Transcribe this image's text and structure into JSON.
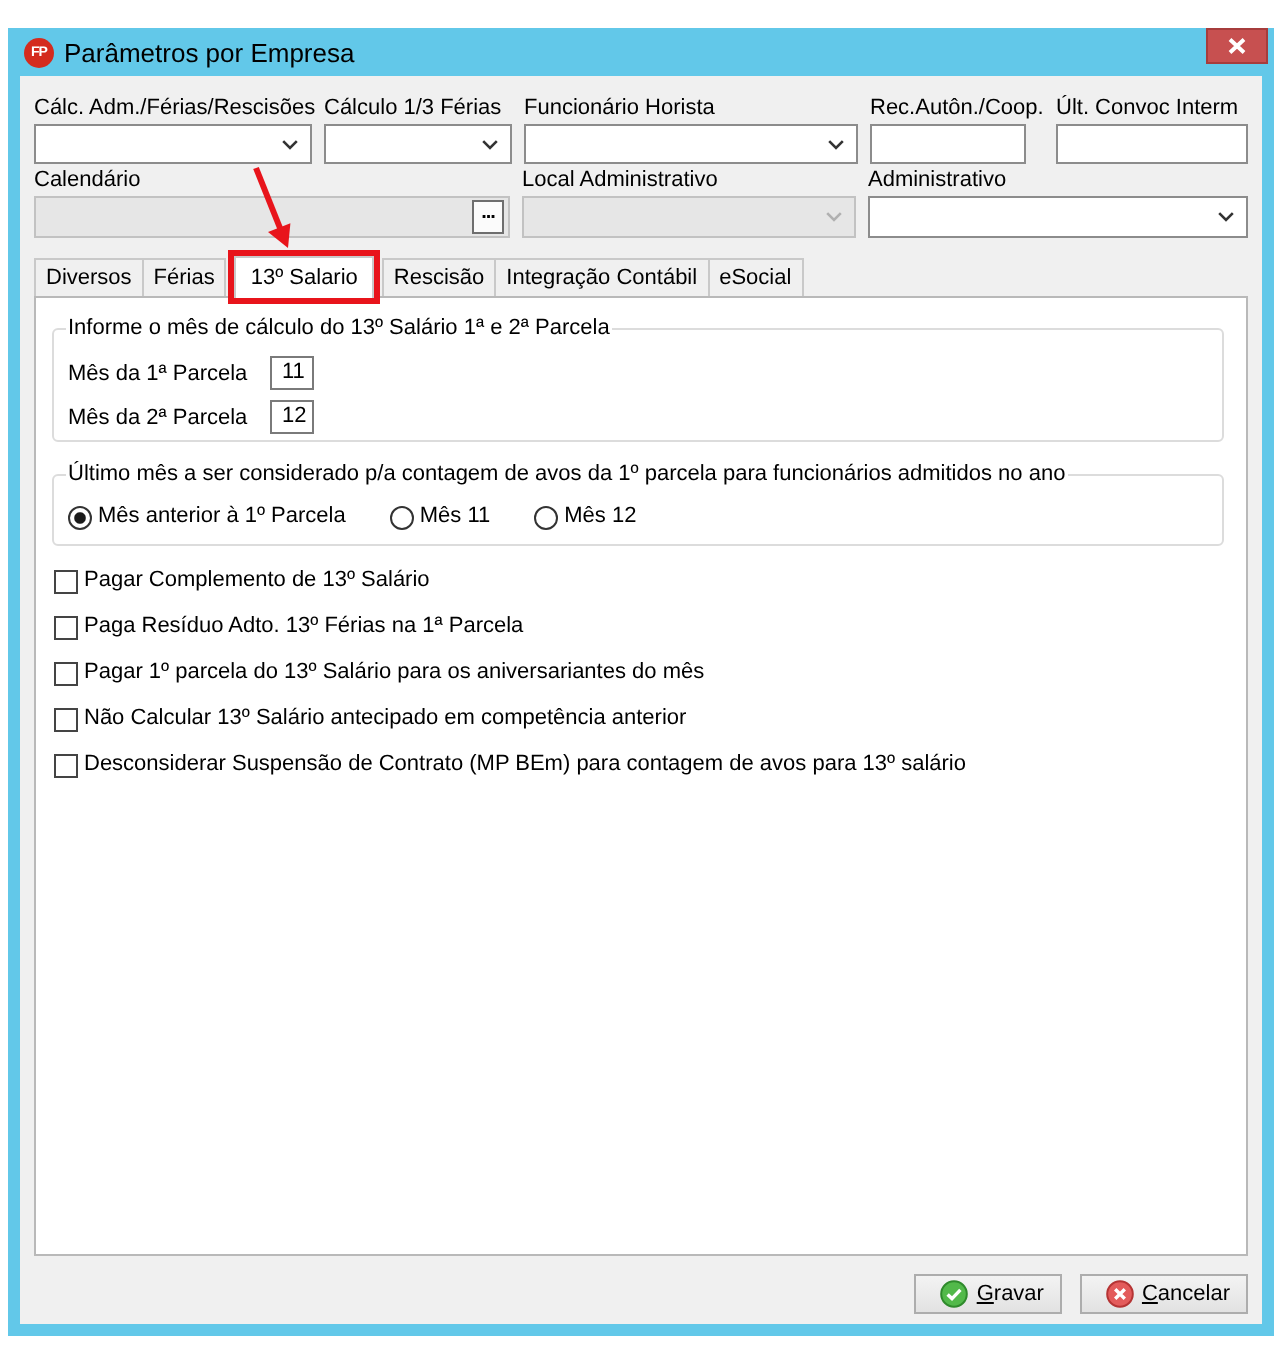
{
  "window": {
    "title": "Parâmetros por Empresa",
    "icon_text": "FP"
  },
  "field_rows": [
    [
      {
        "label": "Cálc. Adm./Férias/Rescisões",
        "kind": "combo",
        "disabled": false
      },
      {
        "label": "Cálculo 1/3 Férias",
        "kind": "combo",
        "disabled": false
      },
      {
        "label": "Funcionário Horista",
        "kind": "combo",
        "disabled": false
      },
      {
        "label": "Rec.Autôn./Coop.",
        "kind": "text",
        "disabled": false
      },
      {
        "label": "Últ. Convoc Interm",
        "kind": "text",
        "disabled": false
      }
    ],
    [
      {
        "label": "Calendário",
        "kind": "browse",
        "disabled": true,
        "button": "..."
      },
      {
        "label": "Local Administrativo",
        "kind": "combo",
        "disabled": true
      },
      {
        "label": "Administrativo",
        "kind": "combo",
        "disabled": false
      }
    ]
  ],
  "tabs": [
    {
      "label": "Diversos",
      "selected": false,
      "highlighted": false
    },
    {
      "label": "Férias",
      "selected": false,
      "highlighted": false
    },
    {
      "label": "13º Salario",
      "selected": true,
      "highlighted": true
    },
    {
      "label": "Rescisão",
      "selected": false,
      "highlighted": false
    },
    {
      "label": "Integração Contábil",
      "selected": false,
      "highlighted": false
    },
    {
      "label": "eSocial",
      "selected": false,
      "highlighted": false
    }
  ],
  "groups": [
    {
      "title": "Informe o mês de cálculo do 13º Salário 1ª e 2ª Parcela",
      "kind": "inputs",
      "rows": [
        {
          "label": "Mês da 1ª Parcela",
          "value": "11"
        },
        {
          "label": "Mês da 2ª Parcela",
          "value": "12"
        }
      ]
    },
    {
      "title": "Último mês a ser considerado p/a contagem de avos da 1º parcela para funcionários admitidos no ano",
      "kind": "radios",
      "options": [
        {
          "label": "Mês anterior à 1º Parcela",
          "selected": true
        },
        {
          "label": "Mês 11",
          "selected": false
        },
        {
          "label": "Mês 12",
          "selected": false
        }
      ]
    }
  ],
  "checkboxes": [
    {
      "label": "Pagar Complemento de 13º Salário",
      "checked": false
    },
    {
      "label": "Paga Resíduo Adto. 13º Férias na 1ª Parcela",
      "checked": false
    },
    {
      "label": "Pagar 1º parcela do 13º Salário para os aniversariantes do mês",
      "checked": false
    },
    {
      "label": "Não Calcular 13º Salário antecipado em competência anterior",
      "checked": false
    },
    {
      "label": "Desconsiderar Suspensão de Contrato (MP BEm) para contagem de avos para 13º salário",
      "checked": false
    }
  ],
  "buttons": [
    {
      "label": "Gravar",
      "kind": "save"
    },
    {
      "label": "Cancelar",
      "kind": "cancel"
    }
  ]
}
